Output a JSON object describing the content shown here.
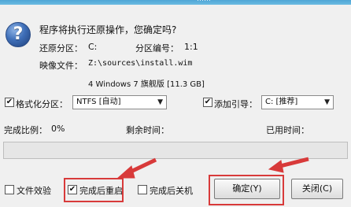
{
  "window": {
    "title_fragment": "……"
  },
  "dialog": {
    "question": "程序将执行还原操作，您确定吗?",
    "restore_partition_label": "还原分区：",
    "restore_partition_value": "C:",
    "partition_number_label": "分区编号：",
    "partition_number_value": "1:1",
    "image_file_label": "映像文件：",
    "image_file_value": "Z:\\sources\\install.wim",
    "image_detail": "4 Windows 7 旗舰版 [11.3 GB]"
  },
  "options": {
    "format_partition": {
      "label": "格式化分区：",
      "checked": true,
      "check_glyph": "✔"
    },
    "filesystem_select": {
      "value": "NTFS [自动]",
      "arrow": "▼"
    },
    "add_boot": {
      "label": "添加引导：",
      "checked": true,
      "check_glyph": "✔"
    },
    "boot_select": {
      "value": "C: [推荐]",
      "arrow": "▼"
    }
  },
  "progress": {
    "ratio_label": "完成比例：",
    "ratio_value": "0%",
    "remaining_label": "剩余时间：",
    "remaining_value": "",
    "elapsed_label": "已用时间：",
    "elapsed_value": "",
    "fraction": 0
  },
  "footer": {
    "file_verify": {
      "label": "文件效验",
      "checked": false,
      "check_glyph": ""
    },
    "reboot_after": {
      "label": "完成后重启",
      "checked": true,
      "check_glyph": "✔"
    },
    "shutdown_after": {
      "label": "完成后关机",
      "checked": false,
      "check_glyph": ""
    },
    "confirm_button": "确定(Y)",
    "close_button": "关闭(C)"
  },
  "colors": {
    "accent_border": "#d83a3a",
    "progress_fill": "#3aa63a",
    "titlebar": "#4fa6d6"
  },
  "icons": {
    "dialog_icon": "question-icon",
    "dialog_icon_glyph": "?"
  }
}
